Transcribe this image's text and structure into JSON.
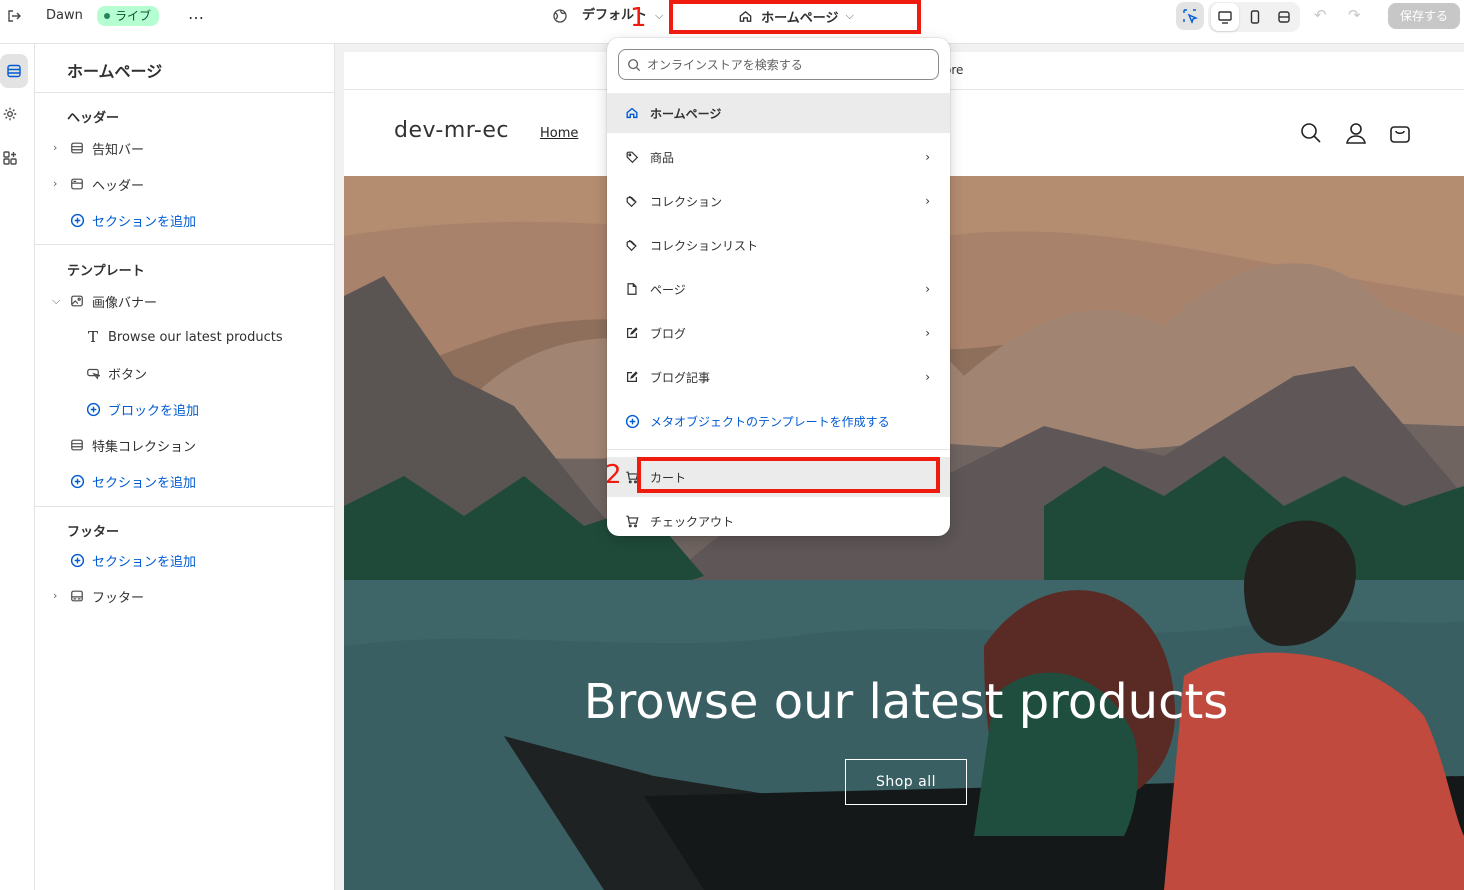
{
  "topbar": {
    "theme_name": "Dawn",
    "live_badge": "ライブ",
    "more_icon": "…",
    "default_label": "デフォルト",
    "page_selector_label": "ホームページ",
    "save_label": "保存する"
  },
  "annotations": {
    "step1": "1",
    "step2": "2"
  },
  "sidebar": {
    "title": "ホームページ",
    "header_group": "ヘッダー",
    "header_items": [
      "告知バー",
      "ヘッダー"
    ],
    "add_section": "セクションを追加",
    "template_group": "テンプレート",
    "image_banner": "画像バナー",
    "banner_blocks": [
      "Browse our latest products",
      "ボタン"
    ],
    "add_block": "ブロックを追加",
    "featured_collection": "特集コレクション",
    "footer_group": "フッター",
    "footer_item": "フッター"
  },
  "dropdown": {
    "search_placeholder": "オンラインストアを検索する",
    "items": [
      {
        "label": "ホームページ",
        "icon": "home-icon"
      },
      {
        "label": "商品",
        "icon": "tag-icon"
      },
      {
        "label": "コレクション",
        "icon": "collection-icon"
      },
      {
        "label": "コレクションリスト",
        "icon": "collection-icon"
      },
      {
        "label": "ページ",
        "icon": "page-icon"
      },
      {
        "label": "ブログ",
        "icon": "blog-icon"
      },
      {
        "label": "ブログ記事",
        "icon": "blog-icon"
      },
      {
        "label": "メタオブジェクトのテンプレートを作成する",
        "icon": "plus-circle-icon"
      },
      {
        "label": "カート",
        "icon": "cart-icon"
      },
      {
        "label": "チェックアウト",
        "icon": "cart-icon"
      }
    ]
  },
  "preview": {
    "announcement_partial": "ore",
    "store_name": "dev-mr-ec",
    "nav_home": "Home",
    "hero_title": "Browse our latest products",
    "hero_button": "Shop all"
  },
  "colors": {
    "accent": "#005bd3",
    "annotation_red": "#ef1b0f",
    "live_badge_bg": "#b4fed2"
  }
}
